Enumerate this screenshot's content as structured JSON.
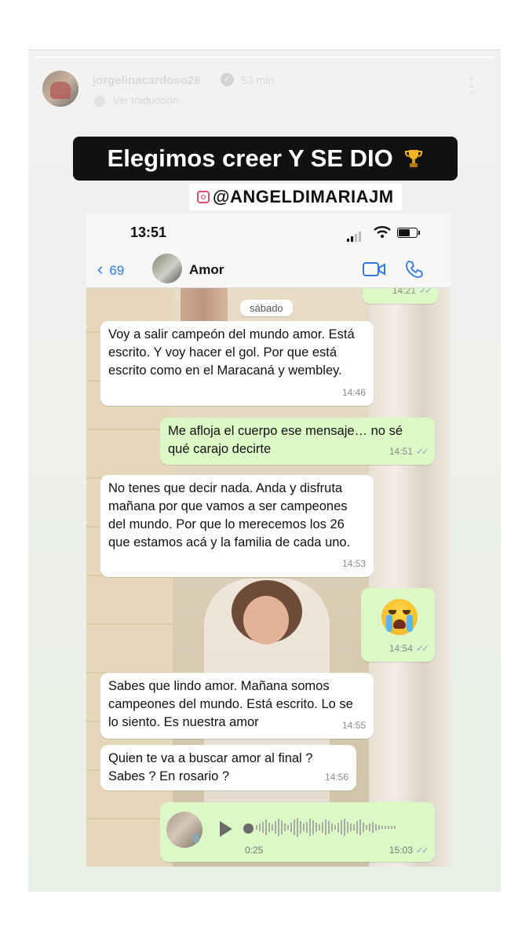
{
  "story": {
    "username": "jorgelinacardoso26",
    "time_ago": "53 min",
    "translate_label": "Ver traducción"
  },
  "headline": {
    "text": "Elegimos creer Y SE DIO",
    "emoji": "trophy-icon"
  },
  "mention": "@ANGELDIMARIAJM",
  "phone": {
    "clock": "13:51",
    "back_count": "69",
    "contact_name": "Amor"
  },
  "chat": {
    "first_time": "14:21",
    "day_badge": "sábado",
    "messages": [
      {
        "type": "in",
        "text": "Voy a salir campeón del mundo amor. Está escrito. Y voy hacer el gol. Por que está escrito como en el Maracaná y wembley.",
        "time": "14:46"
      },
      {
        "type": "out",
        "text": "Me afloja el cuerpo ese mensaje… no sé qué carajo decirte",
        "time": "14:51"
      },
      {
        "type": "in",
        "text": "No tenes que decir nada. Anda y disfruta mañana por que vamos a ser campeones del mundo. Por que lo merecemos los 26 que estamos acá y la familia de cada uno.",
        "time": "14:53"
      },
      {
        "type": "out-emoji",
        "emoji": "crying-face-icon",
        "time": "14:54"
      },
      {
        "type": "in",
        "text": "Sabes que lindo amor. Mañana somos campeones del mundo. Está escrito. Lo se lo siento.  Es nuestra amor",
        "time": "14:55"
      },
      {
        "type": "in",
        "text": "Quien te va a buscar amor al final ? Sabes ? En rosario ?",
        "time": "14:56"
      }
    ],
    "voice_note": {
      "duration": "0:25",
      "time": "15:03"
    }
  },
  "colors": {
    "incoming_bubble": "#ffffff",
    "outgoing_bubble": "#dcf8c6",
    "accent_blue": "#2f7ae5",
    "headline_bg": "#111111"
  }
}
